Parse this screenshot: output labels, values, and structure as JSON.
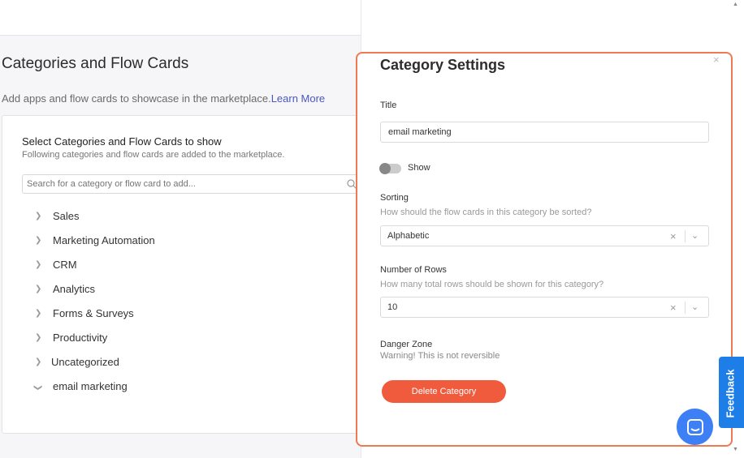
{
  "page": {
    "title": "Categories and Flow Cards",
    "subtitle": "Add apps and flow cards to showcase in the marketplace.",
    "learn_more": "Learn More"
  },
  "card": {
    "title": "Select Categories and Flow Cards to show",
    "subtitle": "Following categories and flow cards are added to the marketplace.",
    "search_placeholder": "Search for a category or flow card to add...",
    "categories": [
      {
        "label": "Sales",
        "expanded": false
      },
      {
        "label": "Marketing Automation",
        "expanded": false
      },
      {
        "label": "CRM",
        "expanded": false
      },
      {
        "label": "Analytics",
        "expanded": false
      },
      {
        "label": "Forms & Surveys",
        "expanded": false
      },
      {
        "label": "Productivity",
        "expanded": false
      },
      {
        "label": "Uncategorized",
        "expanded": false
      },
      {
        "label": "email marketing",
        "expanded": true
      }
    ]
  },
  "settings": {
    "heading": "Category Settings",
    "close": "×",
    "title_label": "Title",
    "title_value": "email marketing",
    "show_label": "Show",
    "show_on": false,
    "sorting_label": "Sorting",
    "sorting_hint": "How should the flow cards in this category be sorted?",
    "sorting_value": "Alphabetic",
    "rows_label": "Number of Rows",
    "rows_hint": "How many total rows should be shown for this category?",
    "rows_value": "10",
    "danger_label": "Danger Zone",
    "danger_hint": "Warning! This is not reversible",
    "delete_label": "Delete Category"
  },
  "widgets": {
    "feedback_label": "Feedback"
  },
  "colors": {
    "accent_border": "#ef7a52",
    "delete": "#f05b3e",
    "link": "#4b55c4",
    "chat": "#3d7ff5",
    "feedback": "#1e7ee8"
  }
}
